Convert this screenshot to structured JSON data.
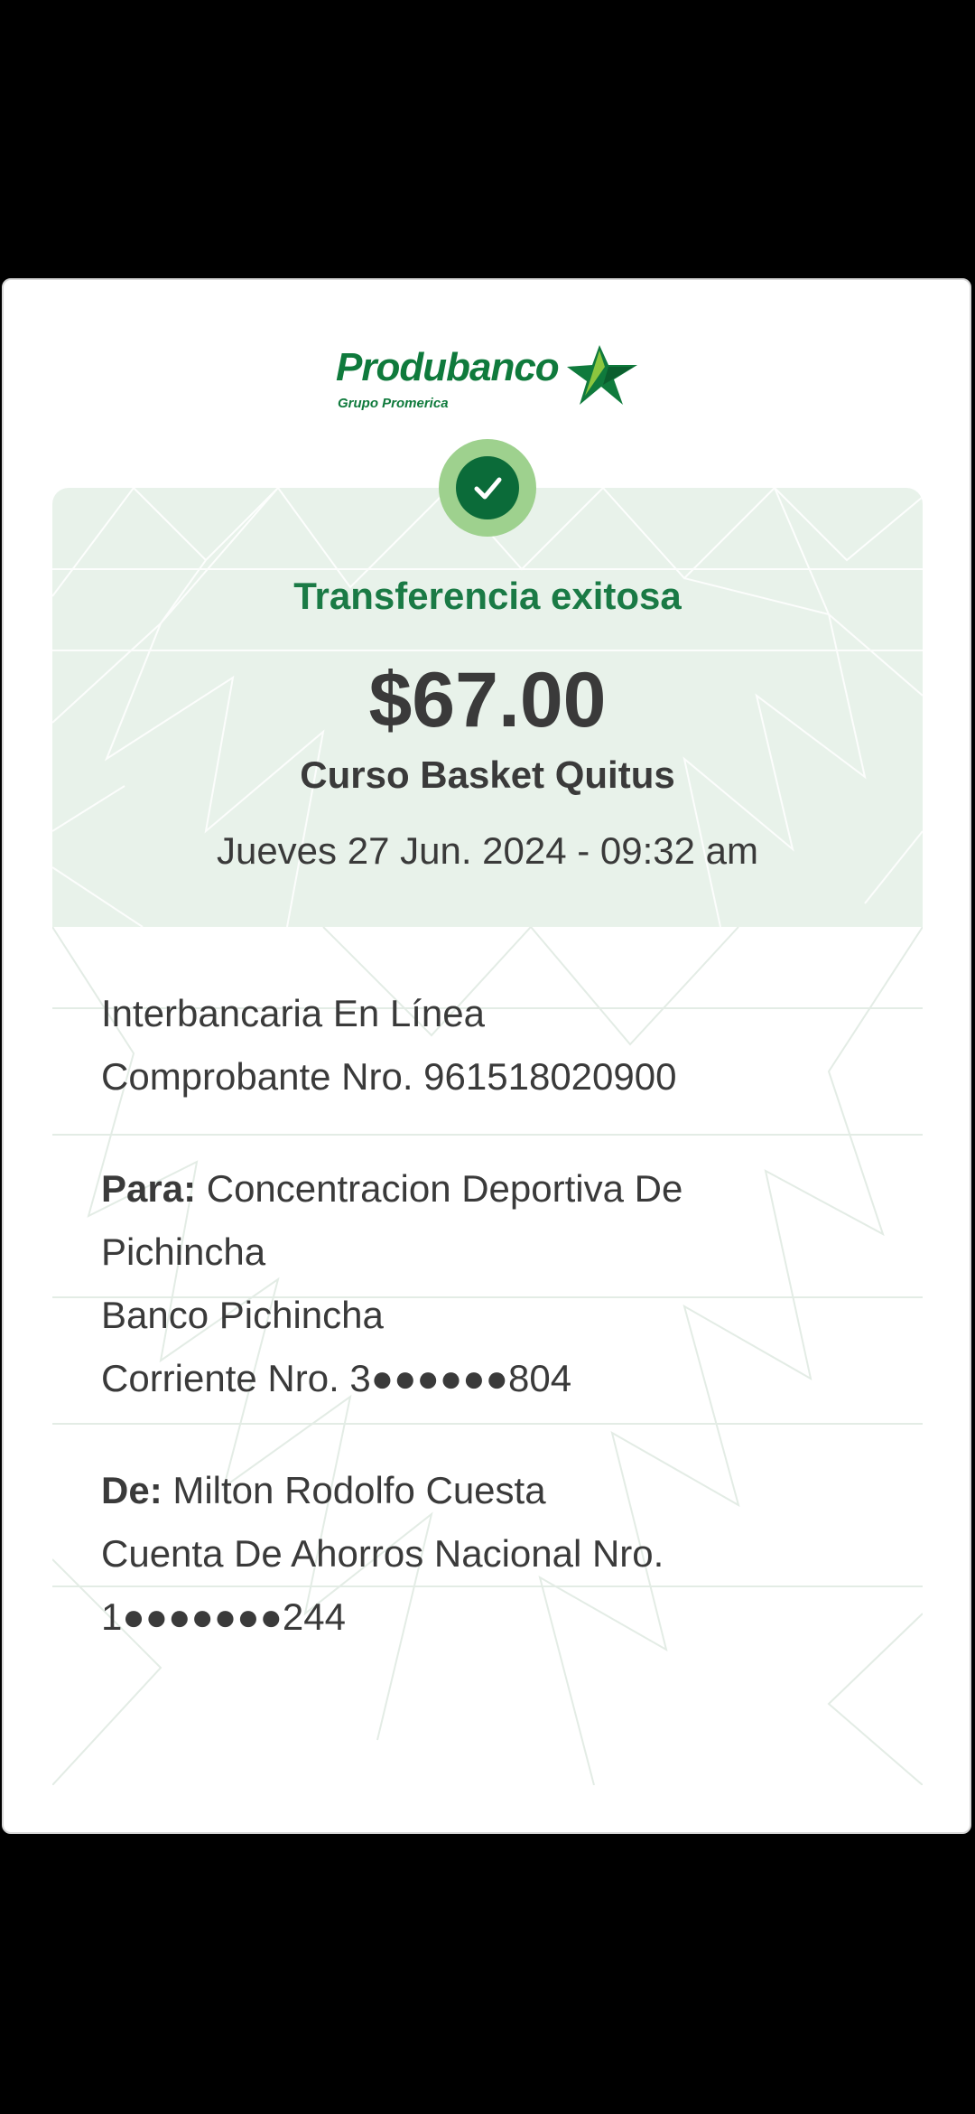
{
  "brand": {
    "name": "Produbanco",
    "tagline": "Grupo Promerica"
  },
  "status": {
    "title": "Transferencia exitosa"
  },
  "transfer": {
    "amount": "$67.00",
    "concept": "Curso Basket Quitus",
    "datetime": "Jueves 27 Jun. 2024 - 09:32 am"
  },
  "details": {
    "type": "Interbancaria En Línea",
    "receipt": "Comprobante Nro. 961518020900",
    "to_label": "Para:",
    "to_name_line1": "Concentracion Deportiva De",
    "to_name_line2": "Pichincha",
    "to_bank": "Banco Pichincha",
    "to_account": "Corriente Nro. 3●●●●●●804",
    "from_label": "De:",
    "from_name": "Milton Rodolfo Cuesta",
    "from_account_line1": "Cuenta De Ahorros Nacional Nro.",
    "from_account_line2": "1●●●●●●●244"
  },
  "colors": {
    "brand_green": "#0f7a3c",
    "header_bg": "#e8f2ea",
    "check_outer": "#9ed18e",
    "check_inner": "#0b6b39"
  },
  "icons": {
    "logo_star": "star-logo-icon",
    "success": "check-icon"
  }
}
